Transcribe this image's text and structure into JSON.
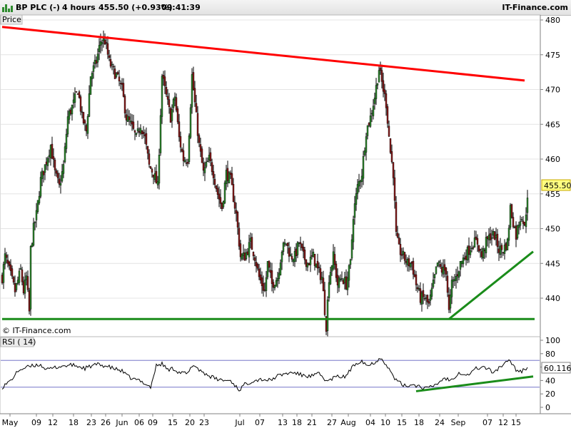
{
  "header": {
    "symbol": "BP PLC (-)",
    "period": "4 hours",
    "price_change": "455.50 (+0.93%)",
    "time": "09:41:39",
    "brand": "IT-Finance.com"
  },
  "price_panel": {
    "label": "Price",
    "watermark": "© IT-Finance.com",
    "last_price_label": "455.50"
  },
  "rsi_panel": {
    "label": "RSI ( 14)",
    "last_value_label": "60.116"
  },
  "colors": {
    "up_candle": "#2e8b2e",
    "down_candle": "#8b1a1a",
    "resistance_line": "#ff0000",
    "support_line": "#1a8c1a",
    "rsi_line": "#000000",
    "last_price_bg": "#ffff80"
  },
  "chart_data": [
    {
      "type": "candlestick",
      "ylim": [
        436,
        480
      ],
      "yticks": [
        440,
        445,
        450,
        455,
        460,
        465,
        470,
        475,
        480
      ],
      "x_tick_labels": [
        "May",
        "09",
        "12",
        "18",
        "23",
        "26",
        "Jun",
        "06",
        "09",
        "15",
        "20",
        "23",
        "Jul",
        "07",
        "13",
        "18",
        "21",
        "27",
        "Aug",
        "04",
        "10",
        "15",
        "18",
        "24",
        "Sep",
        "07",
        "12",
        "15"
      ],
      "close_path": [
        [
          0,
          443
        ],
        [
          2,
          446
        ],
        [
          5,
          444
        ],
        [
          9,
          441
        ],
        [
          13,
          444
        ],
        [
          15,
          441
        ],
        [
          17,
          443
        ],
        [
          19,
          438
        ],
        [
          20,
          447
        ],
        [
          22,
          450
        ],
        [
          24,
          452
        ],
        [
          27,
          457
        ],
        [
          30,
          459
        ],
        [
          34,
          462
        ],
        [
          37,
          458
        ],
        [
          40,
          456
        ],
        [
          43,
          459
        ],
        [
          46,
          466
        ],
        [
          50,
          468
        ],
        [
          53,
          470
        ],
        [
          56,
          466
        ],
        [
          59,
          464
        ],
        [
          62,
          472
        ],
        [
          66,
          474
        ],
        [
          69,
          477
        ],
        [
          72,
          477
        ],
        [
          75,
          474
        ],
        [
          77,
          473
        ],
        [
          80,
          472
        ],
        [
          84,
          470
        ],
        [
          87,
          466
        ],
        [
          90,
          465
        ],
        [
          94,
          463
        ],
        [
          97,
          465
        ],
        [
          100,
          463
        ],
        [
          103,
          459
        ],
        [
          106,
          458
        ],
        [
          109,
          456
        ],
        [
          112,
          472
        ],
        [
          115,
          469
        ],
        [
          118,
          466
        ],
        [
          121,
          469
        ],
        [
          124,
          463
        ],
        [
          127,
          460
        ],
        [
          130,
          460
        ],
        [
          133,
          472
        ],
        [
          135,
          468
        ],
        [
          138,
          462
        ],
        [
          141,
          458
        ],
        [
          145,
          460
        ],
        [
          148,
          458
        ],
        [
          151,
          455
        ],
        [
          154,
          453
        ],
        [
          157,
          458
        ],
        [
          160,
          457
        ],
        [
          164,
          452
        ],
        [
          167,
          446
        ],
        [
          170,
          446
        ],
        [
          174,
          448
        ],
        [
          177,
          446
        ],
        [
          180,
          443
        ],
        [
          184,
          441
        ],
        [
          186,
          445
        ],
        [
          189,
          442
        ],
        [
          193,
          443
        ],
        [
          196,
          447
        ],
        [
          199,
          448
        ],
        [
          202,
          446
        ],
        [
          205,
          446
        ],
        [
          208,
          448
        ],
        [
          211,
          446
        ],
        [
          214,
          445
        ],
        [
          218,
          446
        ],
        [
          221,
          444
        ],
        [
          224,
          443
        ],
        [
          227,
          436
        ],
        [
          229,
          443
        ],
        [
          232,
          446
        ],
        [
          235,
          442
        ],
        [
          238,
          443
        ],
        [
          241,
          442
        ],
        [
          244,
          445
        ],
        [
          246,
          452
        ],
        [
          249,
          456
        ],
        [
          252,
          458
        ],
        [
          255,
          464
        ],
        [
          258,
          466
        ],
        [
          261,
          469
        ],
        [
          264,
          473
        ],
        [
          266,
          471
        ],
        [
          269,
          468
        ],
        [
          272,
          461
        ],
        [
          274,
          458
        ],
        [
          276,
          449
        ],
        [
          278,
          447
        ],
        [
          281,
          446
        ],
        [
          284,
          445
        ],
        [
          287,
          445
        ],
        [
          290,
          442
        ],
        [
          293,
          440
        ],
        [
          296,
          440
        ],
        [
          299,
          439
        ],
        [
          302,
          442
        ],
        [
          305,
          445
        ],
        [
          308,
          444
        ],
        [
          311,
          444
        ],
        [
          313,
          438
        ],
        [
          315,
          442
        ],
        [
          318,
          443
        ],
        [
          321,
          445
        ],
        [
          324,
          446
        ],
        [
          327,
          447
        ],
        [
          330,
          448
        ],
        [
          333,
          448
        ],
        [
          336,
          446
        ],
        [
          339,
          448
        ],
        [
          342,
          449
        ],
        [
          345,
          449
        ],
        [
          348,
          447
        ],
        [
          351,
          447
        ],
        [
          354,
          448
        ],
        [
          356,
          453
        ],
        [
          358,
          451
        ],
        [
          360,
          449
        ],
        [
          362,
          451
        ],
        [
          364,
          452
        ],
        [
          366,
          450
        ],
        [
          368,
          455
        ]
      ],
      "resistance_line": [
        [
          0,
          479
        ],
        [
          366,
          471.3
        ]
      ],
      "support_horizontal": [
        [
          0,
          437
        ],
        [
          373,
          437
        ]
      ],
      "support_rising": [
        [
          313,
          437
        ],
        [
          372,
          446.7
        ]
      ],
      "last_price": 455.5
    },
    {
      "type": "line",
      "name": "RSI ( 14)",
      "ylim": [
        0,
        100
      ],
      "yticks": [
        0,
        20,
        40,
        60,
        80,
        100
      ],
      "reference_levels": [
        30,
        70
      ],
      "values_path": [
        [
          0,
          30
        ],
        [
          6,
          40
        ],
        [
          12,
          56
        ],
        [
          18,
          60
        ],
        [
          26,
          64
        ],
        [
          32,
          56
        ],
        [
          38,
          60
        ],
        [
          44,
          62
        ],
        [
          50,
          63
        ],
        [
          58,
          58
        ],
        [
          66,
          64
        ],
        [
          72,
          62
        ],
        [
          78,
          58
        ],
        [
          84,
          54
        ],
        [
          88,
          46
        ],
        [
          92,
          42
        ],
        [
          96,
          40
        ],
        [
          100,
          36
        ],
        [
          104,
          30
        ],
        [
          108,
          62
        ],
        [
          112,
          65
        ],
        [
          116,
          56
        ],
        [
          120,
          58
        ],
        [
          124,
          52
        ],
        [
          130,
          50
        ],
        [
          134,
          64
        ],
        [
          138,
          56
        ],
        [
          144,
          48
        ],
        [
          150,
          42
        ],
        [
          156,
          40
        ],
        [
          160,
          40
        ],
        [
          166,
          26
        ],
        [
          170,
          34
        ],
        [
          176,
          40
        ],
        [
          182,
          42
        ],
        [
          188,
          40
        ],
        [
          192,
          46
        ],
        [
          198,
          50
        ],
        [
          204,
          52
        ],
        [
          210,
          48
        ],
        [
          216,
          46
        ],
        [
          222,
          50
        ],
        [
          228,
          38
        ],
        [
          232,
          44
        ],
        [
          236,
          46
        ],
        [
          240,
          45
        ],
        [
          244,
          56
        ],
        [
          248,
          66
        ],
        [
          252,
          70
        ],
        [
          256,
          62
        ],
        [
          260,
          66
        ],
        [
          264,
          72
        ],
        [
          266,
          74
        ],
        [
          270,
          60
        ],
        [
          276,
          40
        ],
        [
          282,
          32
        ],
        [
          288,
          34
        ],
        [
          294,
          30
        ],
        [
          298,
          28
        ],
        [
          304,
          34
        ],
        [
          310,
          44
        ],
        [
          314,
          40
        ],
        [
          320,
          52
        ],
        [
          326,
          48
        ],
        [
          332,
          58
        ],
        [
          338,
          60
        ],
        [
          344,
          52
        ],
        [
          350,
          62
        ],
        [
          356,
          70
        ],
        [
          360,
          56
        ],
        [
          364,
          54
        ],
        [
          368,
          60
        ]
      ],
      "trend_line": [
        [
          290,
          24
        ],
        [
          372,
          46
        ]
      ],
      "last_value": 60.116
    }
  ]
}
